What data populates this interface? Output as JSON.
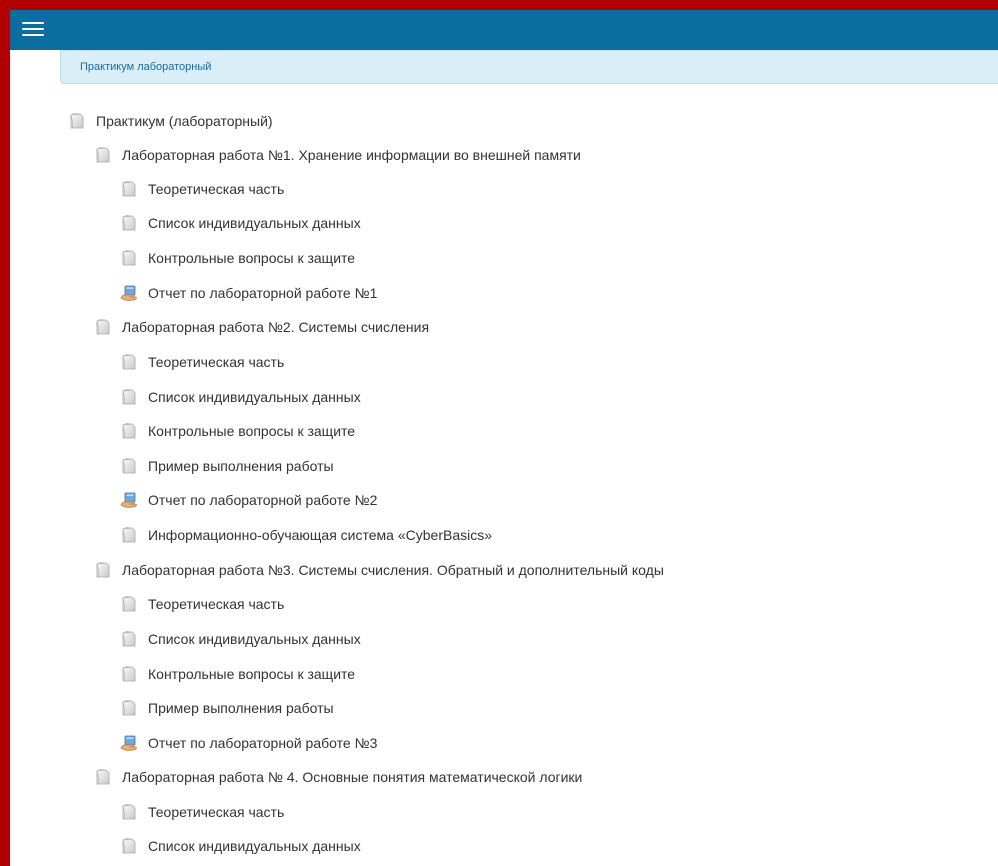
{
  "header": {
    "menu_icon": "hamburger-icon"
  },
  "breadcrumb": {
    "link": "Практикум лабораторный"
  },
  "tree": {
    "root": "Практикум (лабораторный)",
    "labs": [
      {
        "title": "Лабораторная работа №1. Хранение информации во внешней памяти",
        "items": [
          {
            "label": "Теоретическая часть",
            "icon": "page-icon"
          },
          {
            "label": "Список индивидуальных данных",
            "icon": "page-icon"
          },
          {
            "label": "Контрольные вопросы к защите",
            "icon": "page-icon"
          },
          {
            "label": "Отчет по лабораторной работе №1",
            "icon": "assignment-hand-icon"
          }
        ]
      },
      {
        "title": "Лабораторная работа №2. Системы счисления",
        "items": [
          {
            "label": "Теоретическая часть",
            "icon": "page-icon"
          },
          {
            "label": "Список индивидуальных данных",
            "icon": "page-icon"
          },
          {
            "label": "Контрольные вопросы к защите",
            "icon": "page-icon"
          },
          {
            "label": "Пример выполнения работы",
            "icon": "page-icon"
          },
          {
            "label": "Отчет по лабораторной работе №2",
            "icon": "assignment-hand-icon"
          },
          {
            "label": "Информационно-обучающая система «CyberBasics»",
            "icon": "page-icon"
          }
        ]
      },
      {
        "title": "Лабораторная работа №3. Системы счисления. Обратный и дополнительный коды",
        "items": [
          {
            "label": "Теоретическая часть",
            "icon": "page-icon"
          },
          {
            "label": "Список индивидуальных данных",
            "icon": "page-icon"
          },
          {
            "label": "Контрольные вопросы к защите",
            "icon": "page-icon"
          },
          {
            "label": "Пример выполнения работы",
            "icon": "page-icon"
          },
          {
            "label": "Отчет по лабораторной работе №3",
            "icon": "assignment-hand-icon"
          }
        ]
      },
      {
        "title": "Лабораторная работа № 4. Основные понятия математической логики",
        "items": [
          {
            "label": "Теоретическая часть",
            "icon": "page-icon"
          },
          {
            "label": "Список индивидуальных данных",
            "icon": "page-icon"
          }
        ]
      }
    ]
  },
  "colors": {
    "topbar": "#0a6fa0",
    "frame": "#b10000",
    "breadcrumb_bg": "#d9eef6",
    "breadcrumb_link": "#1c6a9b",
    "text": "#333333"
  }
}
